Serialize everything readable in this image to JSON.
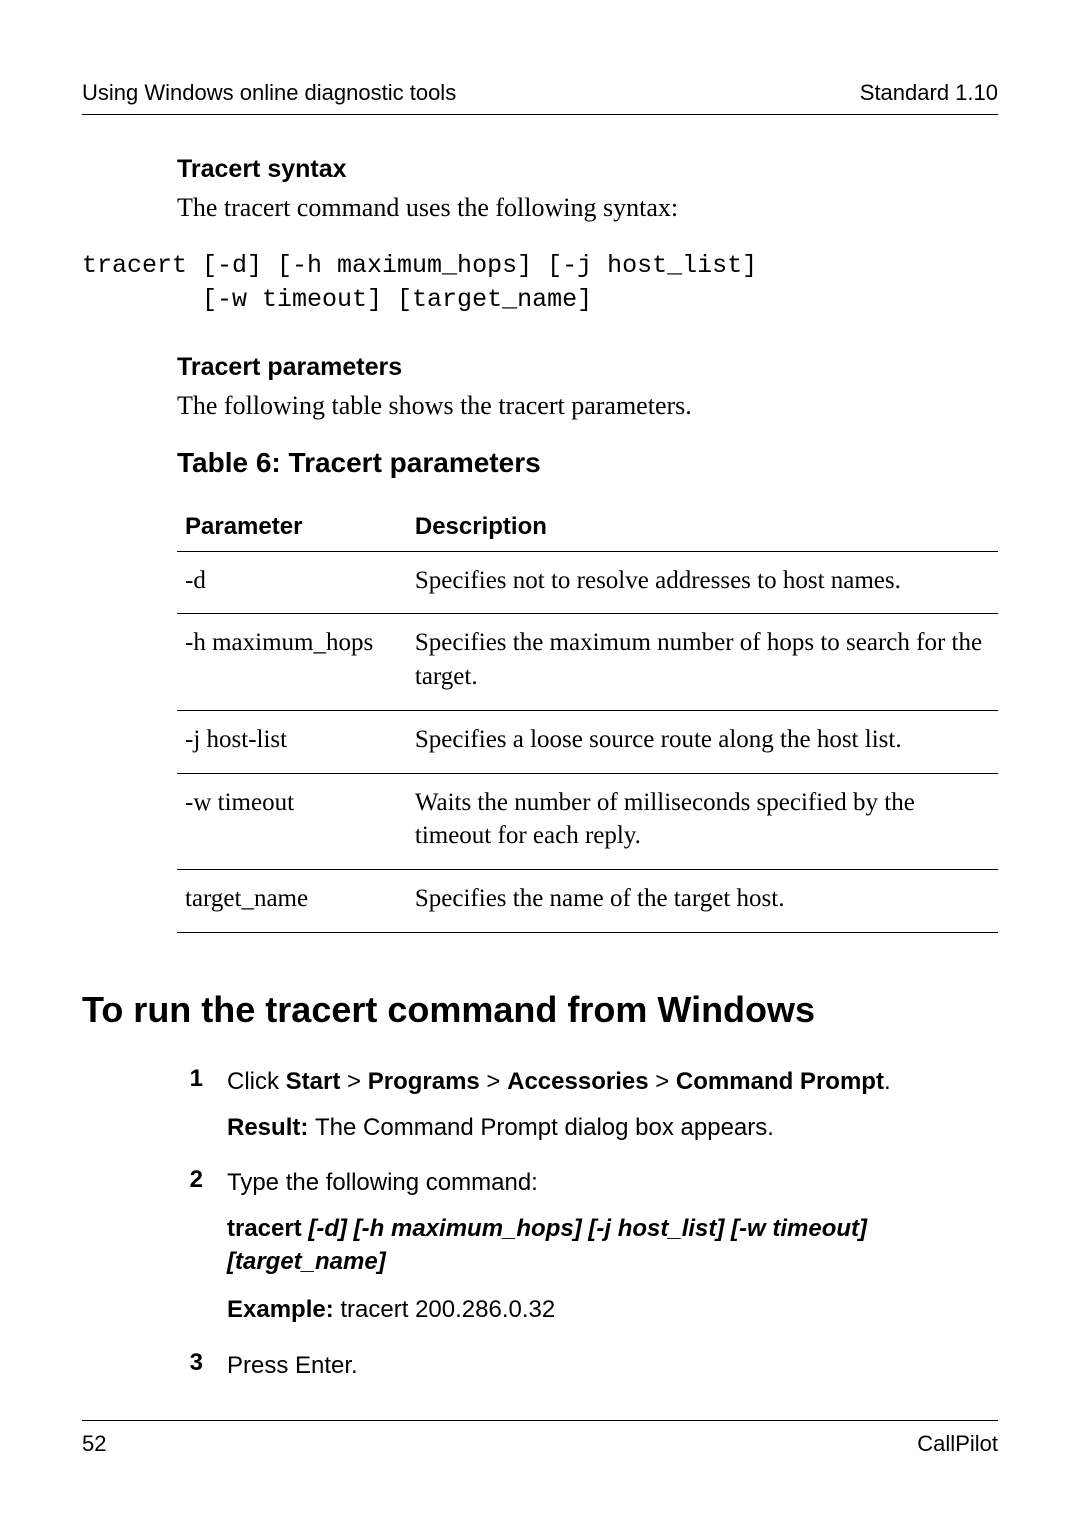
{
  "header": {
    "left": "Using Windows online diagnostic tools",
    "right": "Standard 1.10"
  },
  "syntax": {
    "heading": "Tracert syntax",
    "intro": "The tracert command uses the following syntax:",
    "code": "tracert [-d] [-h maximum_hops] [-j host_list]\n        [-w timeout] [target_name]"
  },
  "params": {
    "heading": "Tracert parameters",
    "intro": "The following table shows the tracert parameters.",
    "table_title": "Table 6: Tracert parameters",
    "col_param": "Parameter",
    "col_desc": "Description",
    "rows": [
      {
        "param": "-d",
        "desc": "Specifies not to resolve addresses to host names."
      },
      {
        "param": "-h maximum_hops",
        "desc": "Specifies the maximum number of hops to search for the target."
      },
      {
        "param": "-j host-list",
        "desc": "Specifies a loose source route along the host list."
      },
      {
        "param": "-w timeout",
        "desc": "Waits the number of milliseconds specified by the timeout for each reply."
      },
      {
        "param": "target_name",
        "desc": "Specifies the name of the target host."
      }
    ]
  },
  "run_section": {
    "heading": "To run the tracert command from Windows",
    "steps": {
      "s1": {
        "num": "1",
        "click": "Click ",
        "b1": "Start",
        "sep": " > ",
        "b2": "Programs",
        "b3": "Accessories",
        "b4": "Command Prompt",
        "period": ".",
        "result_label": "Result: ",
        "result_text": "The Command Prompt dialog box appears."
      },
      "s2": {
        "num": "2",
        "intro": "Type the following command:",
        "cmd_prefix": "tracert ",
        "cmd_args": "[-d] [-h maximum_hops] [-j host_list] [-w timeout] [target_name]",
        "example_label": "Example: ",
        "example_text": "tracert 200.286.0.32"
      },
      "s3": {
        "num": "3",
        "text": "Press Enter."
      }
    }
  },
  "footer": {
    "page": "52",
    "doc": "CallPilot"
  },
  "chart_data": {
    "type": "table",
    "title": "Table 6: Tracert parameters",
    "columns": [
      "Parameter",
      "Description"
    ],
    "rows": [
      [
        "-d",
        "Specifies not to resolve addresses to host names."
      ],
      [
        "-h maximum_hops",
        "Specifies the maximum number of hops to search for the target."
      ],
      [
        "-j host-list",
        "Specifies a loose source route along the host list."
      ],
      [
        "-w timeout",
        "Waits the number of milliseconds specified by the timeout for each reply."
      ],
      [
        "target_name",
        "Specifies the name of the target host."
      ]
    ]
  }
}
